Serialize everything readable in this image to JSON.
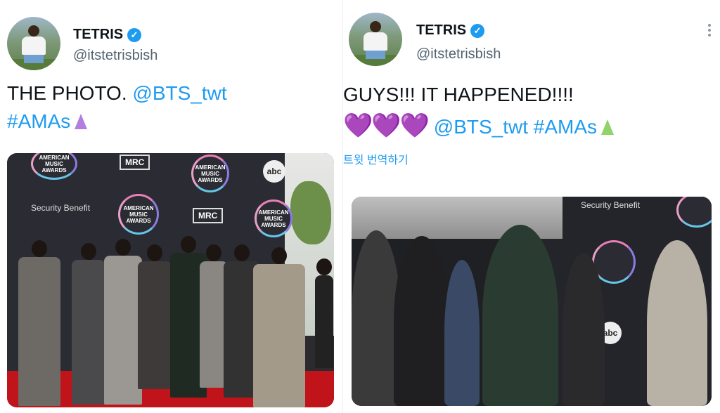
{
  "tweets": [
    {
      "author_name": "TETRIS",
      "verified_mark": "✓",
      "handle": "@itstetrisbish",
      "text_line1_plain": "THE PHOTO. ",
      "text_line1_link": "@BTS_twt",
      "text_line2_link": "#AMAs",
      "photo": {
        "backdrop_logos": [
          "AMERICAN MUSIC AWARDS",
          "MRC",
          "abc"
        ],
        "sponsor": "Security Benefit"
      }
    },
    {
      "author_name": "TETRIS",
      "verified_mark": "✓",
      "handle": "@itstetrisbish",
      "text_line1_plain": "GUYS!!! IT HAPPENED!!!!",
      "hearts": "💜💜💜",
      "text_line2_link": "@BTS_twt #AMAs",
      "translate_label": "트윗 번역하기",
      "photo": {
        "backdrop_logos": [
          "Security Benefit",
          "abc"
        ]
      }
    }
  ],
  "icons": {
    "verified": "verified-badge-icon",
    "more": "more-options-icon",
    "amas_emoji": "prism-emoji-icon"
  },
  "colors": {
    "link": "#1d9bf0",
    "handle": "#536471",
    "verified": "#1d9bf0",
    "heart": "#a98ed9",
    "carpet": "#c0131a"
  }
}
